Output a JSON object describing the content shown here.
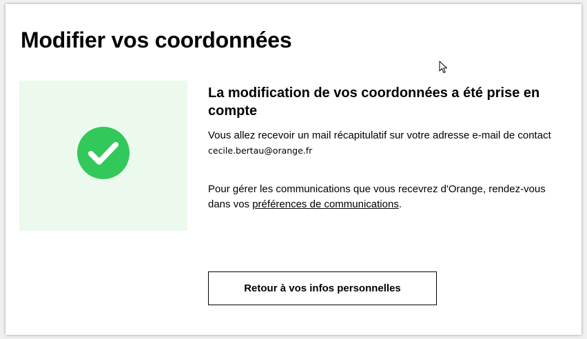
{
  "page": {
    "title": "Modifier vos coordonnées"
  },
  "confirmation": {
    "heading": "La modification de vos coordonnées a été prise en compte",
    "mail_text": "Vous allez recevoir un mail récapitulatif sur votre adresse e-mail de contact",
    "email": "cecile.bertau@orange.fr",
    "prefs_text_before": "Pour gérer les communications que vous recevrez d'Orange, rendez-vous dans vos",
    "prefs_link_label": "préférences de communications",
    "prefs_text_after": "."
  },
  "actions": {
    "back_label": "Retour à vos infos personnelles"
  },
  "icons": {
    "success": "check-circle-icon",
    "pointer": "mouse-cursor-icon"
  },
  "colors": {
    "success_green": "#32c85a",
    "illustration_bg": "#ebfaed"
  }
}
